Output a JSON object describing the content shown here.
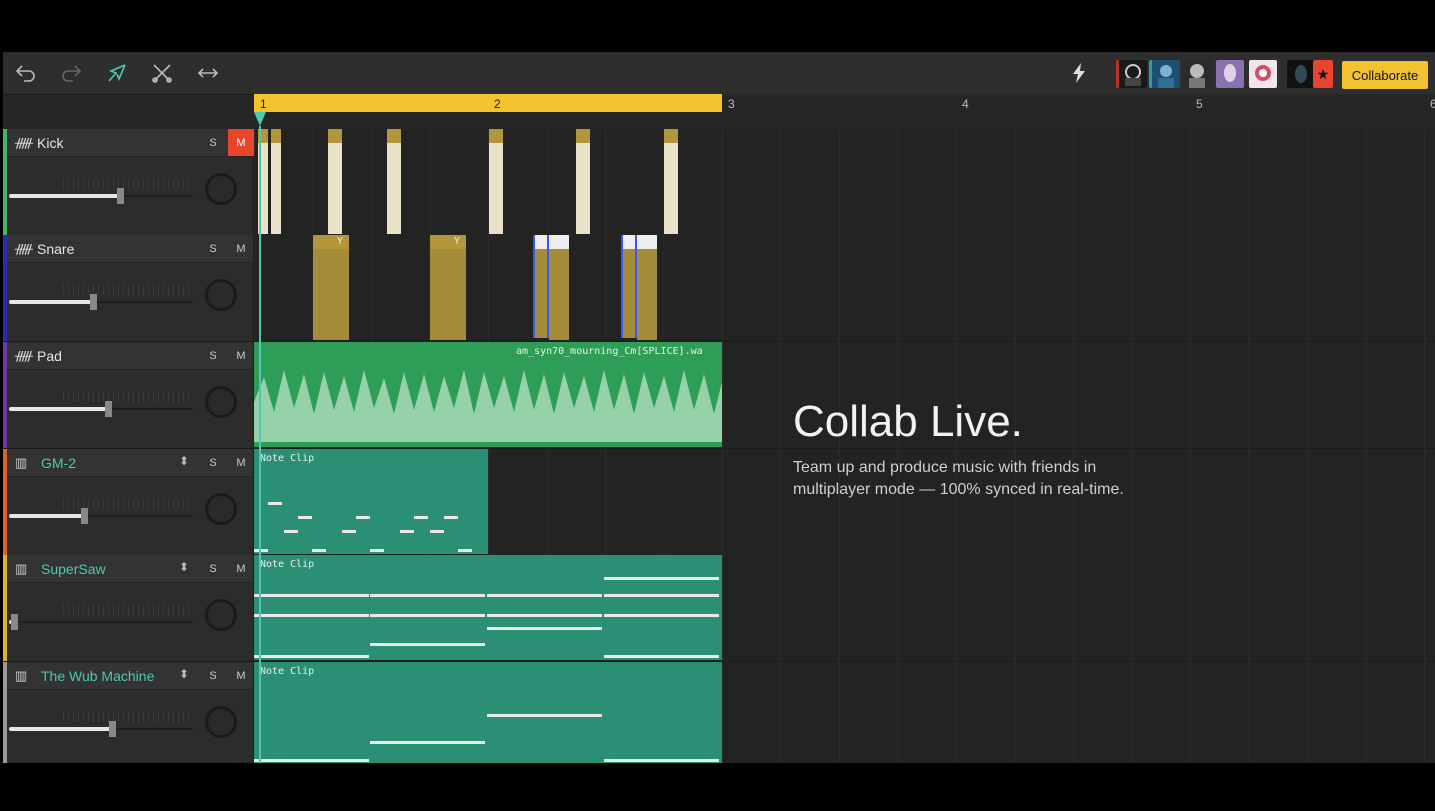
{
  "toolbar": {
    "tools": [
      {
        "name": "undo-icon"
      },
      {
        "name": "redo-icon"
      },
      {
        "name": "pointer-tool-icon"
      },
      {
        "name": "cut-tool-icon"
      },
      {
        "name": "stretch-tool-icon"
      }
    ],
    "bolt_icon": "bolt-icon",
    "collaborators": [
      "#b03020",
      "#2a6f9e",
      "#7a7a7a",
      "#8a6fa8",
      "#d04060",
      "#335566"
    ],
    "star_badge": "★",
    "collaborate_label": "Collaborate",
    "accent": "#f2c230"
  },
  "ruler": {
    "bars": [
      "1",
      "2",
      "3",
      "4",
      "5",
      "6"
    ]
  },
  "tracks": [
    {
      "name": "Kick",
      "type": "audio",
      "icon": "waveform-icon",
      "solo": "S",
      "mute": "M",
      "mute_active": true,
      "volume": 0.6,
      "color": "#46b36a"
    },
    {
      "name": "Snare",
      "type": "audio",
      "icon": "waveform-icon",
      "solo": "S",
      "mute": "M",
      "mute_active": false,
      "volume": 0.45,
      "color": "#2a2ab8"
    },
    {
      "name": "Pad",
      "type": "audio",
      "icon": "waveform-icon",
      "solo": "S",
      "mute": "M",
      "mute_active": false,
      "volume": 0.53,
      "color": "#6a3aa8"
    },
    {
      "name": "GM-2",
      "type": "instrument",
      "icon": "piano-icon",
      "selector": "⬍",
      "solo": "S",
      "mute": "M",
      "mute_active": false,
      "volume": 0.4,
      "color": "#e0602a"
    },
    {
      "name": "SuperSaw",
      "type": "instrument",
      "icon": "piano-icon",
      "selector": "⬍",
      "solo": "S",
      "mute": "M",
      "mute_active": false,
      "volume": 0.02,
      "color": "#e0b030"
    },
    {
      "name": "The Wub Machine",
      "type": "instrument",
      "icon": "piano-icon",
      "selector": "⬍",
      "solo": "S",
      "mute": "M",
      "mute_active": false,
      "volume": 0.55,
      "color": "#9a9a9a"
    }
  ],
  "clips": {
    "pad_label": "am_syn70_mourning_Cm[SPLICE].wa",
    "note_clip_label": "Note Clip",
    "snare_label": "Y"
  },
  "hero": {
    "title": "Collab Live.",
    "text": "Team up and produce music with friends in multiplayer mode — 100% synced in real-time."
  }
}
